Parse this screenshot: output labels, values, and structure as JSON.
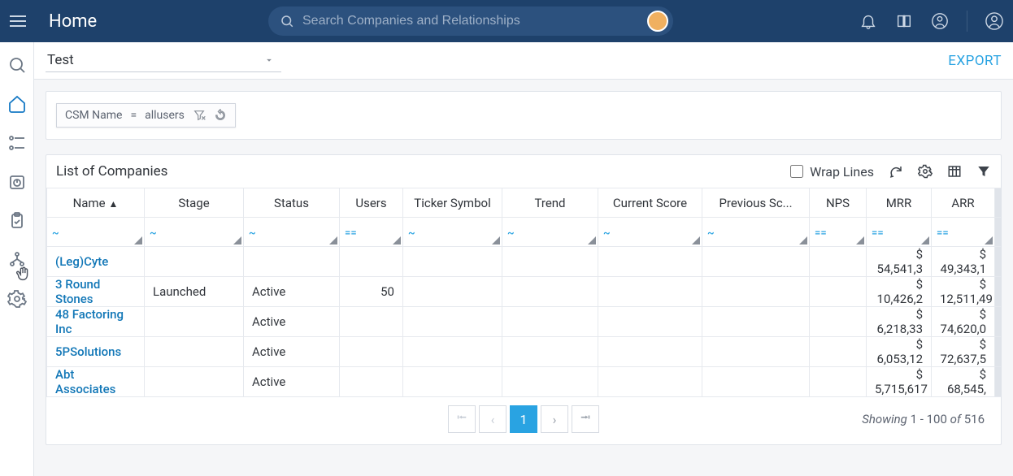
{
  "header": {
    "title": "Home",
    "search_placeholder": "Search Companies and Relationships"
  },
  "subheader": {
    "view_name": "Test",
    "export_label": "EXPORT"
  },
  "filter": {
    "field": "CSM Name",
    "operator": "=",
    "value": "allusers"
  },
  "list": {
    "title": "List of Companies",
    "wrap_label": "Wrap Lines",
    "columns": {
      "name": "Name",
      "stage": "Stage",
      "status": "Status",
      "users": "Users",
      "ticker": "Ticker Symbol",
      "trend": "Trend",
      "current_score": "Current Score",
      "previous_score": "Previous Sc...",
      "nps": "NPS",
      "mrr": "MRR",
      "arr": "ARR"
    },
    "filter_ops": {
      "name": "~",
      "stage": "~",
      "status": "~",
      "users": "==",
      "ticker": "~",
      "trend": "~",
      "current_score": "~",
      "previous_score": "~",
      "nps": "==",
      "mrr": "==",
      "arr": "=="
    },
    "rows": [
      {
        "name": "(Leg)Cyte",
        "stage": "",
        "status": "",
        "users": "",
        "ticker": "",
        "trend": "",
        "current_score": "",
        "previous_score": "",
        "nps": "",
        "mrr": "$ 54,541,3",
        "arr": "$ 49,343,1"
      },
      {
        "name": "3 Round Stones",
        "stage": "Launched",
        "status": "Active",
        "users": "50",
        "ticker": "",
        "trend": "",
        "current_score": "",
        "previous_score": "",
        "nps": "",
        "mrr": "$ 10,426,2",
        "arr": "$ 12,511,49"
      },
      {
        "name": "48 Factoring Inc",
        "stage": "",
        "status": "Active",
        "users": "",
        "ticker": "",
        "trend": "",
        "current_score": "",
        "previous_score": "",
        "nps": "",
        "mrr": "$ 6,218,33",
        "arr": "$ 74,620,0"
      },
      {
        "name": "5PSolutions",
        "stage": "",
        "status": "Active",
        "users": "",
        "ticker": "",
        "trend": "",
        "current_score": "",
        "previous_score": "",
        "nps": "",
        "mrr": "$ 6,053,12",
        "arr": "$ 72,637,5"
      },
      {
        "name": "Abt Associates",
        "stage": "",
        "status": "Active",
        "users": "",
        "ticker": "",
        "trend": "",
        "current_score": "",
        "previous_score": "",
        "nps": "",
        "mrr": "$ 5,715,617",
        "arr": "$ 68,545,"
      }
    ]
  },
  "pagination": {
    "current_page": "1",
    "showing_label": "Showing",
    "range": "1 - 100",
    "of_label": "of",
    "total": "516"
  }
}
